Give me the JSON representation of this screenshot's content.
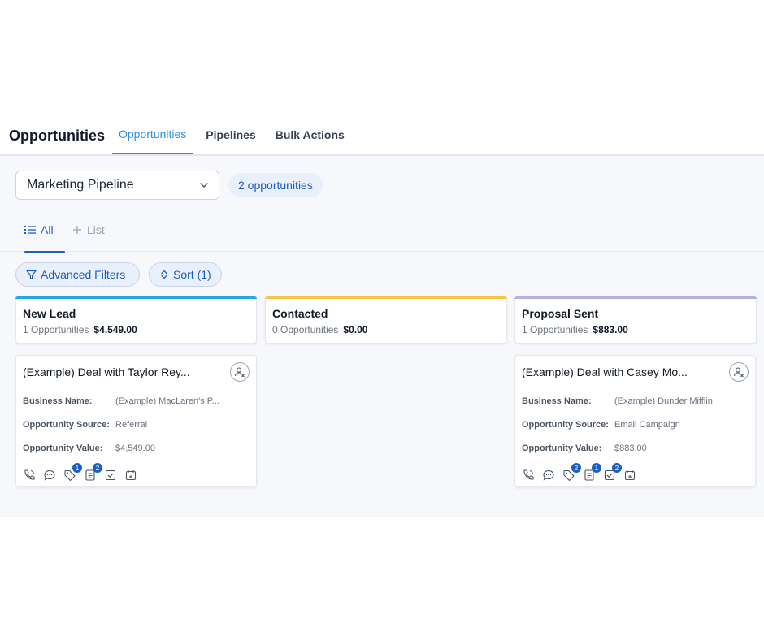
{
  "header": {
    "title": "Opportunities",
    "tabs": [
      {
        "label": "Opportunities",
        "active": true
      },
      {
        "label": "Pipelines"
      },
      {
        "label": "Bulk Actions"
      }
    ]
  },
  "toolbar": {
    "pipeline_value": "Marketing Pipeline",
    "opportunity_count": "2 opportunities"
  },
  "view_tabs": {
    "all_label": "All",
    "list_label": "List"
  },
  "filters": {
    "advanced_label": "Advanced Filters",
    "sort_label": "Sort (1)"
  },
  "colors": {
    "accent": "#1d5ec4",
    "tab_active": "#2a91d6",
    "stage_new_lead": "#22a7e0",
    "stage_contacted": "#f5c542",
    "stage_proposal": "#b6b0e0"
  },
  "columns": [
    {
      "name": "New Lead",
      "count": "1 Opportunities",
      "amount": "$4,549.00"
    },
    {
      "name": "Contacted",
      "count": "0 Opportunities",
      "amount": "$0.00"
    },
    {
      "name": "Proposal Sent",
      "count": "1 Opportunities",
      "amount": "$883.00"
    }
  ],
  "field_labels": {
    "business": "Business Name:",
    "source": "Opportunity Source:",
    "value": "Opportunity Value:"
  },
  "cards": [
    {
      "title": "(Example) Deal with Taylor Rey...",
      "business": "(Example) MacLaren's P...",
      "source": "Referral",
      "value": "$4,549.00",
      "badges": {
        "tag": "1",
        "notes": "2"
      }
    },
    {
      "title": "(Example) Deal with Casey Mo...",
      "business": "(Example) Dunder Mifflin",
      "source": "Email Campaign",
      "value": "$883.00",
      "badges": {
        "tag": "2",
        "notes": "1",
        "tasks": "2"
      }
    }
  ]
}
